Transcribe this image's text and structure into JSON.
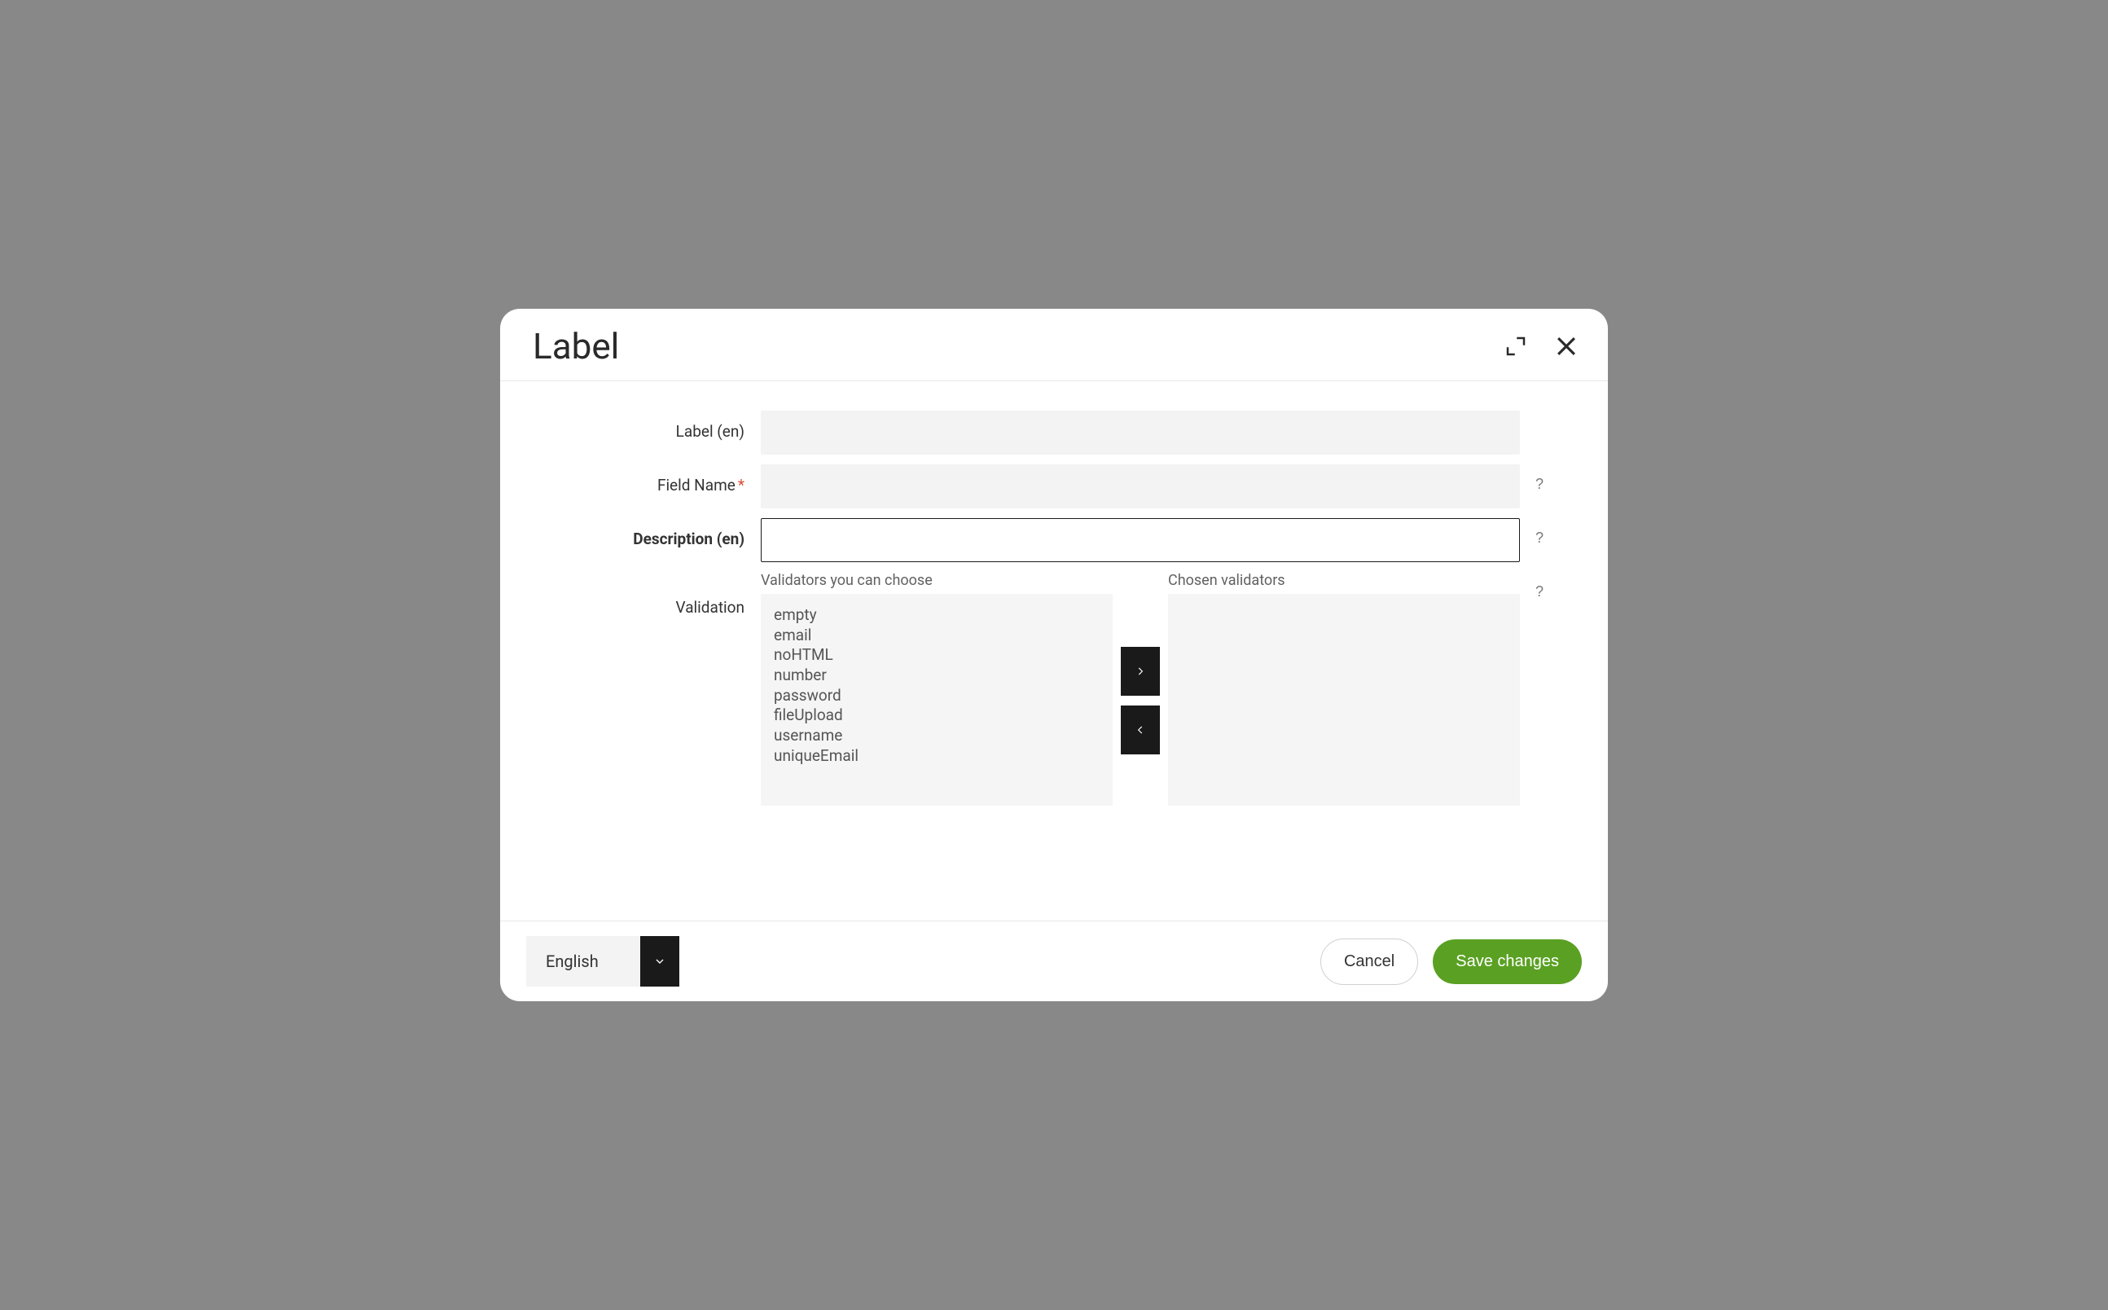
{
  "modal": {
    "title": "Label"
  },
  "form": {
    "label_en_label": "Label (en)",
    "label_en_value": "",
    "fieldname_label": "Field Name",
    "fieldname_value": "",
    "description_label": "Description (en)",
    "description_value": "",
    "validation_label": "Validation"
  },
  "validators": {
    "available_heading": "Validators you can choose",
    "chosen_heading": "Chosen validators",
    "available": [
      "empty",
      "email",
      "noHTML",
      "number",
      "password",
      "fileUpload",
      "username",
      "uniqueEmail"
    ],
    "chosen": []
  },
  "footer": {
    "language": "English",
    "cancel": "Cancel",
    "save": "Save changes"
  },
  "help_marker": "?"
}
